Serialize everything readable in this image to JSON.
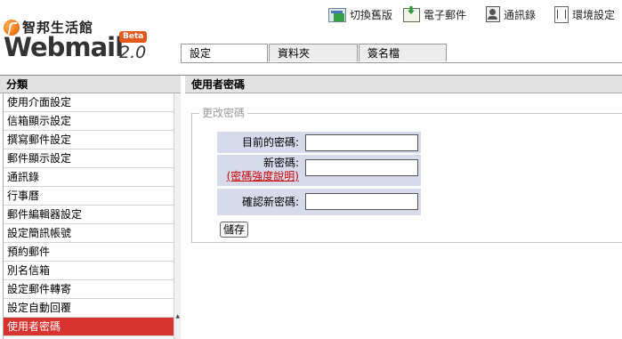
{
  "brand": {
    "name_cn": "智邦生活館",
    "product": "Webmail",
    "badge": "Beta",
    "version": "2.0"
  },
  "top_nav": [
    {
      "label": "切換舊版",
      "icon": "switch-version-icon"
    },
    {
      "label": "電子郵件",
      "icon": "email-download-icon"
    },
    {
      "label": "通訊錄",
      "icon": "address-book-icon"
    },
    {
      "label": "環境設定",
      "icon": "settings-icon"
    }
  ],
  "tabs": [
    {
      "label": "設定",
      "active": true
    },
    {
      "label": "資料夾",
      "active": false
    },
    {
      "label": "簽名檔",
      "active": false
    }
  ],
  "sidebar": {
    "title": "分類",
    "items": [
      {
        "label": "使用介面設定"
      },
      {
        "label": "信箱顯示設定"
      },
      {
        "label": "撰寫郵件設定"
      },
      {
        "label": "郵件顯示設定"
      },
      {
        "label": "通訊錄"
      },
      {
        "label": "行事曆"
      },
      {
        "label": "郵件編輯器設定"
      },
      {
        "label": "設定簡訊帳號"
      },
      {
        "label": "預約郵件"
      },
      {
        "label": "別名信箱"
      },
      {
        "label": "設定郵件轉寄"
      },
      {
        "label": "設定自動回覆"
      },
      {
        "label": "使用者密碼",
        "active": true
      }
    ]
  },
  "main": {
    "title": "使用者密碼",
    "section_legend": "更改密碼",
    "fields": {
      "current_password": {
        "label": "目前的密碼:",
        "value": ""
      },
      "new_password": {
        "label": "新密碼:",
        "value": "",
        "help_link": "(密碼強度說明)"
      },
      "confirm_password": {
        "label": "確認新密碼:",
        "value": ""
      }
    },
    "save_label": "儲存"
  },
  "colors": {
    "active_item_bg": "#d8332f",
    "label_cell_bg": "#d7daeb",
    "help_link": "#cc0000",
    "brand_orange": "#e2591b"
  }
}
